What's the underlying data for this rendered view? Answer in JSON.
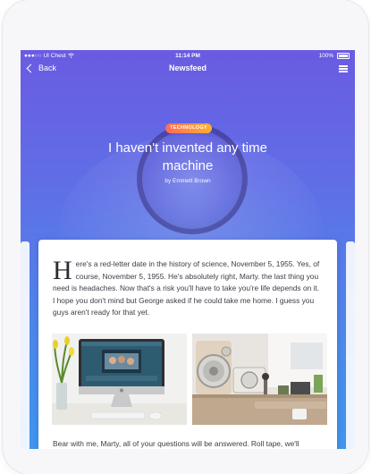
{
  "status": {
    "carrier": "UI Chest",
    "time": "11:14 PM",
    "battery": "100%"
  },
  "nav": {
    "back_label": "Back",
    "title": "Newsfeed"
  },
  "hero": {
    "tag": "TECHNOLOGY",
    "title": "I haven't invented any time machine",
    "byline": "by Emmett Brown"
  },
  "article": {
    "dropcap": "H",
    "body": "ere's a red-letter date in the history of science, November 5, 1955. Yes, of course, November 5, 1955. He's absolutely right, Marty. the last thing you need is headaches. Now that's a risk you'll have to take you're life depends on it. I hope you don't mind but George asked if he could take me home. I guess you guys aren't ready for that yet.",
    "footer": "Bear with me, Marty, all of your questions will be answered. Roll tape, we'll"
  },
  "colors": {
    "gradient_top": "#6a5be2",
    "gradient_bottom": "#3f95ee",
    "tag_start": "#ff6a5a",
    "tag_end": "#ffb12c"
  },
  "icons": [
    "wifi-icon",
    "battery-icon",
    "chevron-left-icon",
    "menu-list-icon"
  ]
}
